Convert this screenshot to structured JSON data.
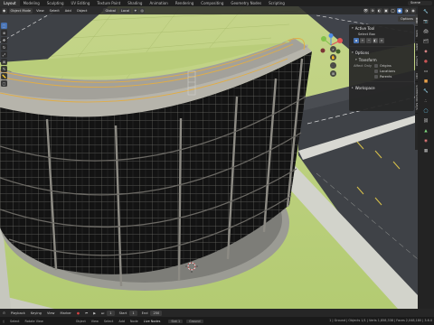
{
  "topbar": {
    "tabs": [
      "Layout",
      "Modeling",
      "Sculpting",
      "UV Editing",
      "Texture Paint",
      "Shading",
      "Animation",
      "Rendering",
      "Compositing",
      "Geometry Nodes",
      "Scripting"
    ],
    "active_tab": "Layout",
    "scene": "Scene"
  },
  "viewport_header": {
    "mode": "Object Mode",
    "view_menu": "View",
    "select_menu": "Select",
    "add_menu": "Add",
    "object_menu": "Object",
    "orientation": "Global",
    "pivot": "Local",
    "options": "Options"
  },
  "npanel": {
    "active_tool_title": "Active Tool",
    "select_box": "Select Box",
    "options_title": "Options",
    "transform_title": "Transform",
    "affect_only_label": "Affect Only",
    "affect_origins": "Origins",
    "affect_locations": "Locations",
    "affect_parents": "Parents",
    "workspace_title": "Workspace"
  },
  "sidebar_tabs": [
    "Tool",
    "View",
    "Item",
    "Create",
    "Edit",
    "Screencast Keys"
  ],
  "timeline": {
    "playback": "Playback",
    "keying": "Keying",
    "view": "View",
    "marker": "Marker",
    "start_label": "Start",
    "start": "1",
    "end_label": "End",
    "end": "250",
    "frame": "1"
  },
  "statusbar": {
    "select": "Select",
    "rotate_view": "Rotate View",
    "object": "Object",
    "view": "View",
    "select_menu": "Select",
    "add": "Add",
    "node": "Node",
    "live_nodes": "Live Nodes",
    "slot": "Slot 1",
    "ground": "Ground",
    "info": "1 | Ground | Objects 1/1 | Verts 1,858,338 | Faces 2,048,180 | 3.6.0"
  },
  "colors": {
    "accent": "#4772b3",
    "grass": "#b7cf76",
    "road": "#3f4247",
    "glass": "#141414",
    "railing": "#e4b04a",
    "concrete": "#8c8c86"
  }
}
